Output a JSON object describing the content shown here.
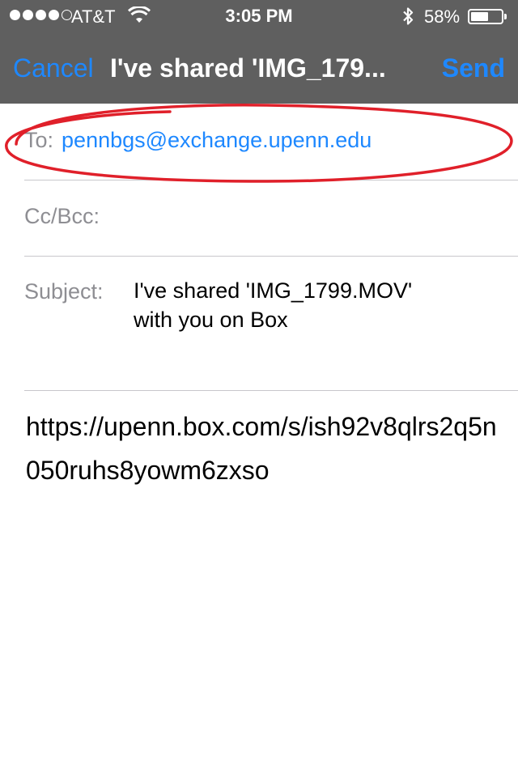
{
  "status_bar": {
    "carrier": "AT&T",
    "time": "3:05 PM",
    "battery_percent": "58%",
    "battery_level": 0.58,
    "signal_bars_filled": 4,
    "signal_bars_total": 5
  },
  "nav": {
    "cancel_label": "Cancel",
    "title": "I've shared 'IMG_179...",
    "send_label": "Send"
  },
  "fields": {
    "to_label": "To:",
    "to_value": "pennbgs@exchange.upenn.edu",
    "cc_label": "Cc/Bcc:",
    "subject_label": "Subject:",
    "subject_value": "I've shared 'IMG_1799.MOV' with you on Box"
  },
  "body": {
    "text": "https://upenn.box.com/s/ish92v8qlrs2q5n050ruhs8yowm6zxso"
  },
  "colors": {
    "header_bg": "#5f5f5f",
    "accent": "#1e88ff",
    "annotation": "#e0202a"
  },
  "icons": [
    "wifi-icon",
    "bluetooth-icon",
    "battery-icon"
  ]
}
